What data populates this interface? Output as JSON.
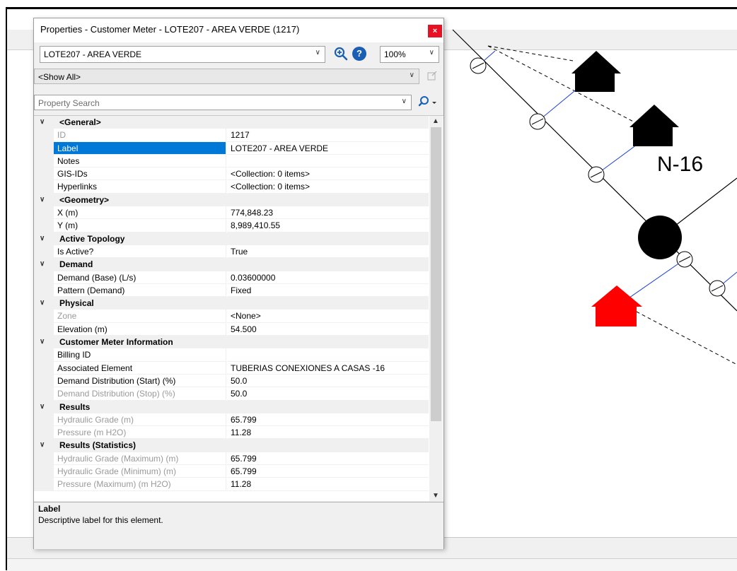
{
  "window": {
    "title": "Properties - Customer Meter - LOTE207 - AREA VERDE (1217)",
    "close_glyph": "×"
  },
  "toolbar": {
    "element_value": "LOTE207 - AREA VERDE",
    "zoom_value": "100%",
    "zoom_in_icon": "zoom-in-icon",
    "help_icon": "help-icon",
    "help_glyph": "?",
    "filter_value": "<Show All>",
    "search_placeholder": "Property Search",
    "dropdown_glyph": "∨"
  },
  "grid": {
    "rows": [
      {
        "kind": "cat",
        "label": "<General>"
      },
      {
        "kind": "prop",
        "name": "ID",
        "value": "1217",
        "readonly": true
      },
      {
        "kind": "prop",
        "name": "Label",
        "value": "LOTE207 - AREA VERDE",
        "selected": true
      },
      {
        "kind": "prop",
        "name": "Notes",
        "value": ""
      },
      {
        "kind": "prop",
        "name": "GIS-IDs",
        "value": "<Collection: 0 items>"
      },
      {
        "kind": "prop",
        "name": "Hyperlinks",
        "value": "<Collection: 0 items>"
      },
      {
        "kind": "cat",
        "label": "<Geometry>"
      },
      {
        "kind": "prop",
        "name": "X (m)",
        "value": "774,848.23"
      },
      {
        "kind": "prop",
        "name": "Y (m)",
        "value": "8,989,410.55"
      },
      {
        "kind": "cat",
        "label": "Active Topology"
      },
      {
        "kind": "prop",
        "name": "Is Active?",
        "value": "True"
      },
      {
        "kind": "cat",
        "label": "Demand"
      },
      {
        "kind": "prop",
        "name": "Demand (Base) (L/s)",
        "value": "0.03600000"
      },
      {
        "kind": "prop",
        "name": "Pattern (Demand)",
        "value": "Fixed"
      },
      {
        "kind": "cat",
        "label": "Physical"
      },
      {
        "kind": "prop",
        "name": "Zone",
        "value": "<None>",
        "readonly": true
      },
      {
        "kind": "prop",
        "name": "Elevation (m)",
        "value": "54.500"
      },
      {
        "kind": "cat",
        "label": "Customer Meter Information"
      },
      {
        "kind": "prop",
        "name": "Billing ID",
        "value": ""
      },
      {
        "kind": "prop",
        "name": "Associated Element",
        "value": "TUBERIAS CONEXIONES A CASAS -16"
      },
      {
        "kind": "prop",
        "name": "Demand Distribution (Start) (%)",
        "value": "50.0"
      },
      {
        "kind": "prop",
        "name": "Demand Distribution (Stop) (%)",
        "value": "50.0",
        "readonly": true
      },
      {
        "kind": "cat",
        "label": "Results"
      },
      {
        "kind": "prop",
        "name": "Hydraulic Grade (m)",
        "value": "65.799",
        "readonly": true
      },
      {
        "kind": "prop",
        "name": "Pressure (m H2O)",
        "value": "11.28",
        "readonly": true
      },
      {
        "kind": "cat",
        "label": "Results (Statistics)"
      },
      {
        "kind": "prop",
        "name": "Hydraulic Grade (Maximum) (m)",
        "value": "65.799",
        "readonly": true
      },
      {
        "kind": "prop",
        "name": "Hydraulic Grade (Minimum) (m)",
        "value": "65.799",
        "readonly": true
      },
      {
        "kind": "prop",
        "name": "Pressure (Maximum) (m H2O)",
        "value": "11.28",
        "readonly": true
      }
    ]
  },
  "description": {
    "title": "Label",
    "text": "Descriptive label for this element."
  },
  "map": {
    "node_label": "N-16",
    "house_color_default": "#000000",
    "house_color_selected": "#ff0000",
    "lateral_color": "#1a3fd6"
  }
}
